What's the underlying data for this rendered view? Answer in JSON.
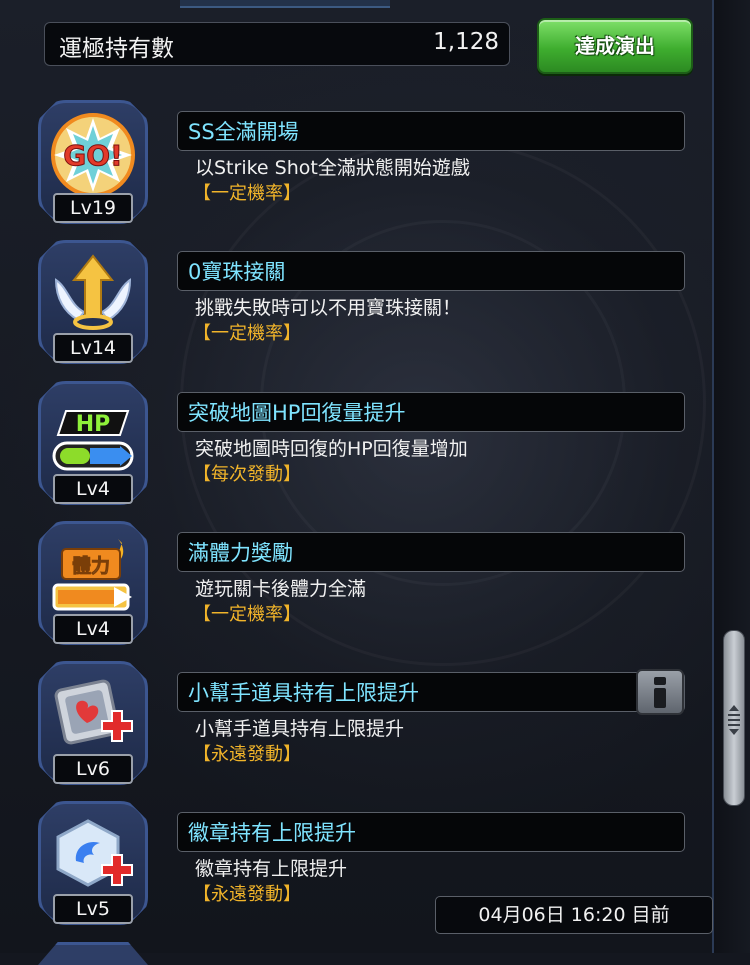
{
  "header": {
    "luck_label": "運極持有數",
    "luck_value": "1,128",
    "achieve_button": "達成演出"
  },
  "bonuses": [
    {
      "level": "Lv19",
      "title": "SS全滿開場",
      "description": "以Strike Shot全滿狀態開始遊戲",
      "tag": "【一定機率】",
      "icon": "go-burst-icon"
    },
    {
      "level": "Lv14",
      "title": "0寶珠接關",
      "description": "挑戰失敗時可以不用寶珠接關！",
      "tag": "【一定機率】",
      "icon": "winged-arrow-icon"
    },
    {
      "level": "Lv4",
      "title": "突破地圖HP回復量提升",
      "description": "突破地圖時回復的HP回復量增加",
      "tag": "【每次發動】",
      "icon": "hp-gauge-icon"
    },
    {
      "level": "Lv4",
      "title": "滿體力獎勵",
      "description": "遊玩關卡後體力全滿",
      "tag": "【一定機率】",
      "icon": "stamina-icon",
      "icon_text": "體力"
    },
    {
      "level": "Lv6",
      "title": "小幫手道具持有上限提升",
      "description": "小幫手道具持有上限提升",
      "tag": "【永遠發動】",
      "icon": "item-plus-icon",
      "has_info": true
    },
    {
      "level": "Lv5",
      "title": "徽章持有上限提升",
      "description": "徽章持有上限提升",
      "tag": "【永遠發動】",
      "icon": "badge-plus-icon"
    }
  ],
  "timestamp": "04月06日 16:20 目前",
  "colors": {
    "title_text": "#7fe4ff",
    "tag_text": "#f1b42a",
    "button_green": "#3fae2f"
  }
}
